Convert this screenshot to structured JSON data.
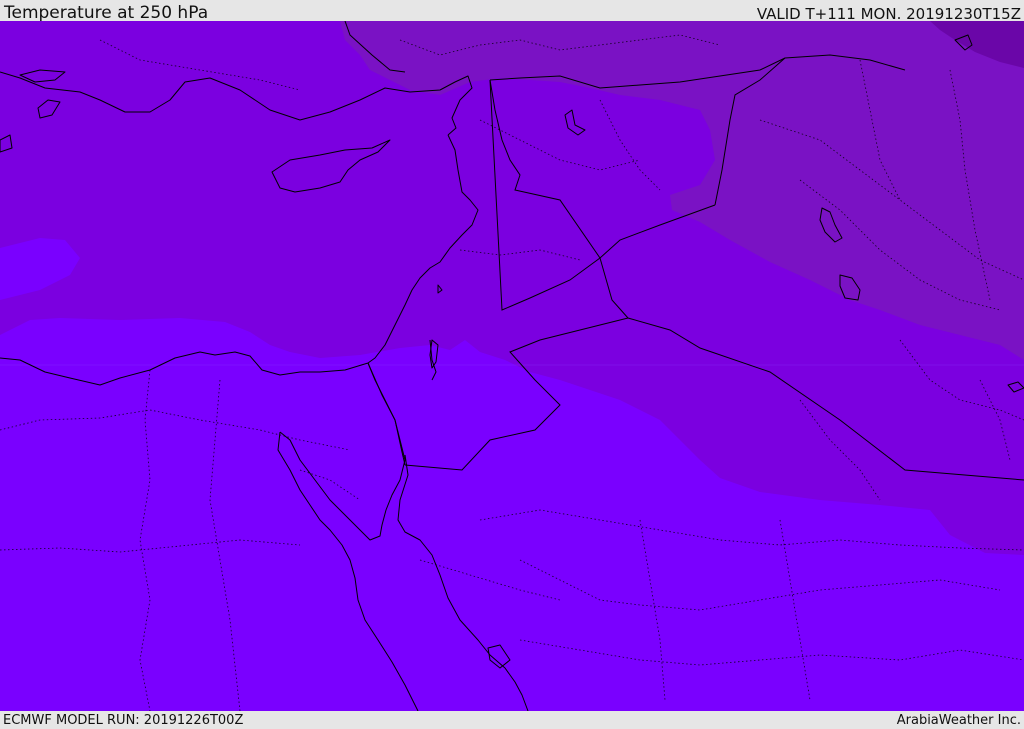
{
  "header": {
    "title": "Temperature at 250 hPa",
    "valid_time": "VALID T+111 MON. 20191230T15Z"
  },
  "footer": {
    "model_run": "ECMWF MODEL RUN: 20191226T00Z",
    "credit": "ArabiaWeather Inc."
  },
  "map": {
    "variable": "temperature",
    "pressure_level_hpa": 250,
    "field_colors": {
      "warmest": "#7a00ff",
      "mid": "#7b00e0",
      "cooler": "#7a12c4",
      "coldest": "#6a06a8"
    },
    "border_color": "#000000"
  }
}
